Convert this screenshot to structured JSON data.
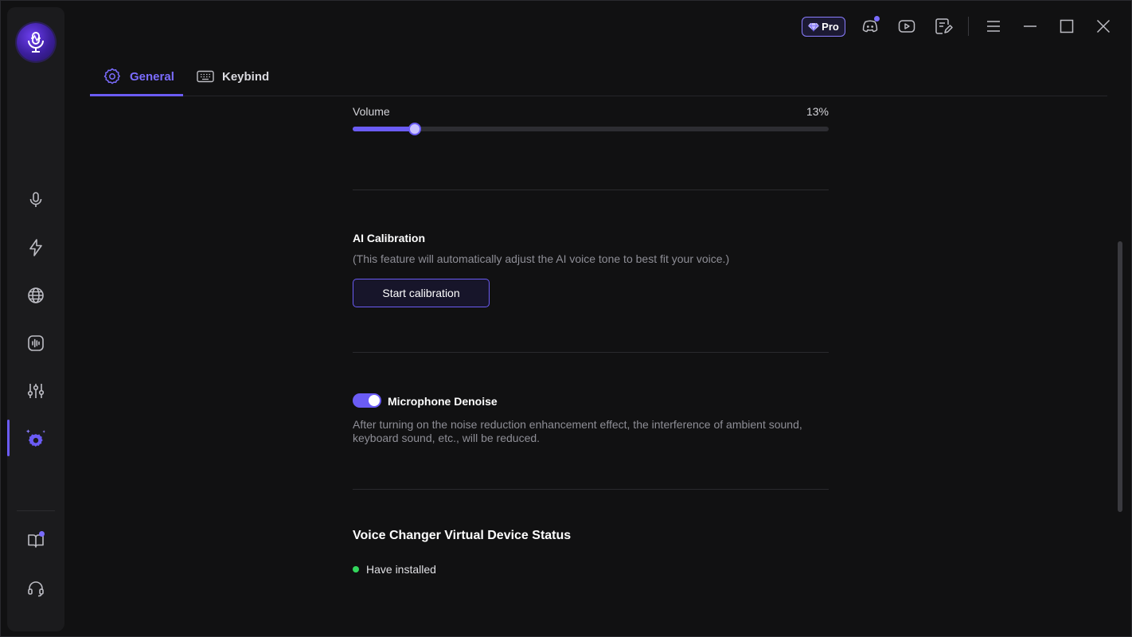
{
  "header": {
    "pro_label": "Pro",
    "icons": [
      "pro-gem-icon",
      "discord-icon",
      "youtube-icon",
      "feedback-icon",
      "menu-icon",
      "minimize-icon",
      "maximize-icon",
      "close-icon"
    ]
  },
  "sidebar": {
    "items": [
      {
        "name": "microphone-icon"
      },
      {
        "name": "lightning-icon"
      },
      {
        "name": "globe-icon"
      },
      {
        "name": "soundwave-icon"
      },
      {
        "name": "sliders-icon"
      },
      {
        "name": "settings-icon",
        "active": true
      },
      {
        "name": "book-icon"
      },
      {
        "name": "headset-icon"
      }
    ]
  },
  "tabs": [
    {
      "label": "General",
      "active": true,
      "icon": "gear-icon"
    },
    {
      "label": "Keybind",
      "active": false,
      "icon": "keyboard-icon"
    }
  ],
  "volume": {
    "label": "Volume",
    "value_text": "13%",
    "value": 0.13
  },
  "calibration": {
    "title": "AI Calibration",
    "description": "(This feature will automatically adjust the AI voice tone to best fit your voice.)",
    "button": "Start calibration"
  },
  "denoise": {
    "title": "Microphone Denoise",
    "enabled": true,
    "description": "After turning on the noise reduction enhancement effect, the interference of ambient sound, keyboard sound, etc., will be reduced."
  },
  "device_status": {
    "title": "Voice Changer Virtual Device Status",
    "status": "Have installed"
  },
  "colors": {
    "accent": "#6b5cf5",
    "status_ok": "#33d65c"
  }
}
